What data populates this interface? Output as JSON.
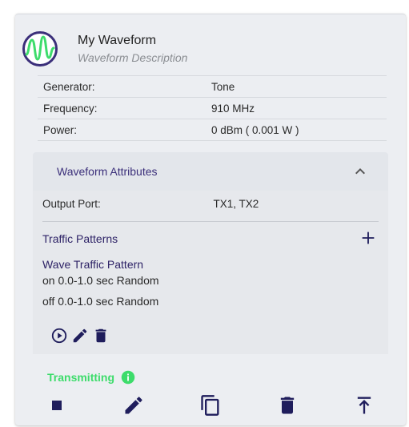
{
  "card": {
    "title": "My Waveform",
    "subtitle": "Waveform Description"
  },
  "props": [
    {
      "label": "Generator:",
      "value": "Tone"
    },
    {
      "label": "Frequency:",
      "value": "910 MHz"
    },
    {
      "label": "Power:",
      "value": "0 dBm ( 0.001 W )"
    }
  ],
  "attributes": {
    "title": "Waveform Attributes",
    "output_port_label": "Output Port:",
    "output_port_value": "TX1, TX2",
    "traffic_title": "Traffic Patterns",
    "pattern": {
      "name": "Wave Traffic Pattern",
      "on": "on 0.0-1.0 sec Random",
      "off": "off 0.0-1.0 sec Random"
    }
  },
  "status": {
    "label": "Transmitting",
    "color": "#3ddc6b"
  },
  "colors": {
    "accent": "#1f1d5c",
    "logo_ring": "#3b2f7a",
    "logo_wave": "#3ddc6b"
  },
  "icons": {
    "logo": "waveform-logo-icon",
    "collapse": "chevron-up-icon",
    "add": "plus-icon",
    "play": "play-circle-icon",
    "edit": "pencil-icon",
    "delete": "trash-icon",
    "stop": "stop-icon",
    "copy": "copy-icon",
    "upload": "upload-icon",
    "info": "info-icon"
  }
}
